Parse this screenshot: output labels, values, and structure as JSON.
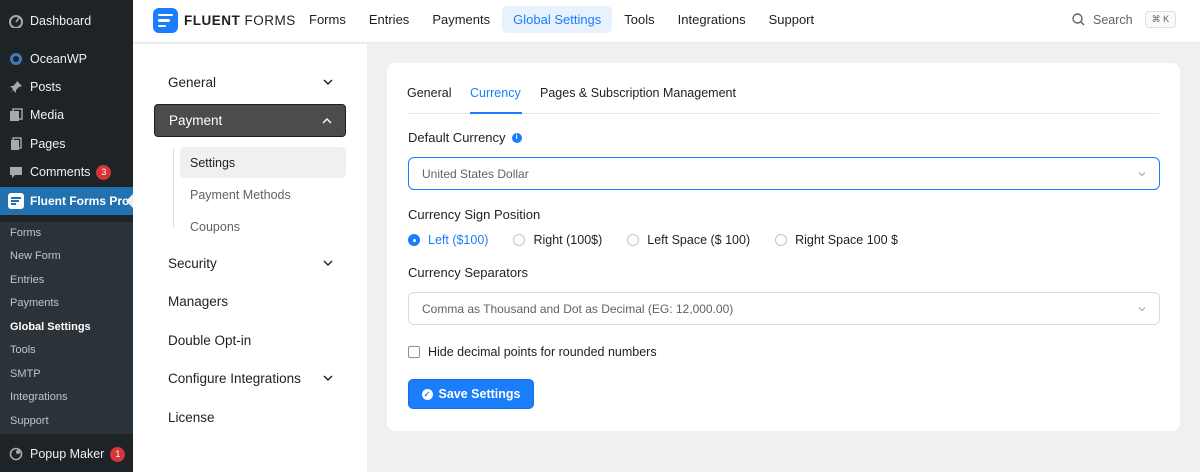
{
  "wp_menu": {
    "items": [
      {
        "label": "Dashboard",
        "icon": "dashboard-icon"
      },
      {
        "label": "OceanWP",
        "icon": "oceanwp-icon"
      },
      {
        "label": "Posts",
        "icon": "pin-icon"
      },
      {
        "label": "Media",
        "icon": "media-icon"
      },
      {
        "label": "Pages",
        "icon": "pages-icon"
      },
      {
        "label": "Comments",
        "icon": "comment-icon",
        "badge": "3"
      },
      {
        "label": "Fluent Forms Pro",
        "icon": "fluent-forms-icon"
      }
    ],
    "subitems": [
      "Forms",
      "New Form",
      "Entries",
      "Payments",
      "Global Settings",
      "Tools",
      "SMTP",
      "Integrations",
      "Support"
    ],
    "popup": {
      "label": "Popup Maker",
      "badge": "1",
      "icon": "popup-maker-icon"
    }
  },
  "header": {
    "logo_bold": "FLUENT",
    "logo_light": "FORMS",
    "nav": [
      "Forms",
      "Entries",
      "Payments",
      "Global Settings",
      "Tools",
      "Integrations",
      "Support"
    ],
    "active_nav": "Global Settings",
    "search_label": "Search",
    "search_shortcut": "⌘ K"
  },
  "settings_menu": {
    "general": "General",
    "payment": "Payment",
    "payment_sub": [
      "Settings",
      "Payment Methods",
      "Coupons"
    ],
    "security": "Security",
    "managers": "Managers",
    "double_optin": "Double Opt-in",
    "configure_integrations": "Configure Integrations",
    "license": "License"
  },
  "main": {
    "tabs": [
      "General",
      "Currency",
      "Pages & Subscription Management"
    ],
    "active_tab": "Currency",
    "default_currency_label": "Default Currency",
    "default_currency_value": "United States Dollar",
    "sign_position_label": "Currency Sign Position",
    "sign_options": [
      "Left ($100)",
      "Right (100$)",
      "Left Space ($ 100)",
      "Right Space 100 $"
    ],
    "sign_selected": "Left ($100)",
    "separators_label": "Currency Separators",
    "separators_value": "Comma as Thousand and Dot as Decimal (EG: 12,000.00)",
    "hide_decimal_label": "Hide decimal points for rounded numbers",
    "hide_decimal_checked": false,
    "save_label": "Save Settings"
  },
  "colors": {
    "accent": "#1a7efb",
    "wp_sidebar": "#1d2327",
    "wp_active": "#2271b1"
  }
}
